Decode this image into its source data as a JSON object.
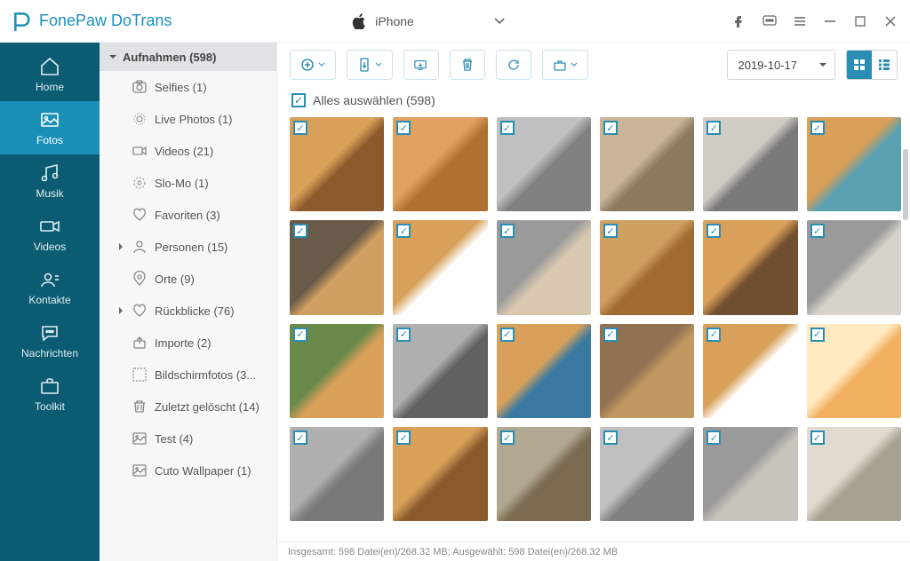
{
  "app": {
    "name": "FonePaw DoTrans"
  },
  "device": {
    "name": "iPhone"
  },
  "sidebar": {
    "items": [
      {
        "label": "Home"
      },
      {
        "label": "Fotos"
      },
      {
        "label": "Musik"
      },
      {
        "label": "Videos"
      },
      {
        "label": "Kontakte"
      },
      {
        "label": "Nachrichten"
      },
      {
        "label": "Toolkit"
      }
    ]
  },
  "categories": {
    "header": "Aufnahmen (598)",
    "items": [
      {
        "label": "Selfies (1)"
      },
      {
        "label": "Live Photos (1)"
      },
      {
        "label": "Videos (21)"
      },
      {
        "label": "Slo-Mo (1)"
      },
      {
        "label": "Favoriten (3)"
      },
      {
        "label": "Personen (15)",
        "expandable": true
      },
      {
        "label": "Orte (9)"
      },
      {
        "label": "Rückblicke (76)",
        "expandable": true
      },
      {
        "label": "Importe (2)"
      },
      {
        "label": "Bildschirmfotos (3..."
      },
      {
        "label": "Zuletzt gelöscht (14)"
      },
      {
        "label": "Test (4)"
      },
      {
        "label": "Cuto Wallpaper (1)"
      }
    ]
  },
  "selectAll": {
    "label": "Alles auswählen (598)"
  },
  "date": {
    "value": "2019-10-17"
  },
  "status": {
    "text": "Insgesamt: 598 Datei(en)/268.32 MB; Ausgewählt: 598 Datei(en)/268.32 MB"
  },
  "thumbs": [
    {
      "a": "#d9a05a",
      "b": "#8b5a2b"
    },
    {
      "a": "#e0a060",
      "b": "#b07030"
    },
    {
      "a": "#c0c0c0",
      "b": "#808080"
    },
    {
      "a": "#cab49a",
      "b": "#8a7a60"
    },
    {
      "a": "#d0ccc4",
      "b": "#7a7a7a"
    },
    {
      "a": "#d9a05a",
      "b": "#5aa0b0"
    },
    {
      "a": "#6a5a4a",
      "b": "#d0a060"
    },
    {
      "a": "#d9a05a",
      "b": "#ffffff"
    },
    {
      "a": "#9a9a9a",
      "b": "#d8c8b0"
    },
    {
      "a": "#d0a060",
      "b": "#a06a30"
    },
    {
      "a": "#d9a05a",
      "b": "#705030"
    },
    {
      "a": "#9a9a9a",
      "b": "#d8d4cc"
    },
    {
      "a": "#6a8a4a",
      "b": "#d9a05a"
    },
    {
      "a": "#b0b0b0",
      "b": "#606060"
    },
    {
      "a": "#d9a05a",
      "b": "#3a7aa0"
    },
    {
      "a": "#907050",
      "b": "#c09860"
    },
    {
      "a": "#d9a05a",
      "b": "#ffffff"
    },
    {
      "a": "#ffe9c0",
      "b": "#f0b060"
    },
    {
      "a": "#b0b0b0",
      "b": "#7a7a7a"
    },
    {
      "a": "#d9a05a",
      "b": "#8b5a2b"
    },
    {
      "a": "#b0a890",
      "b": "#7a6a50"
    },
    {
      "a": "#c0c0c0",
      "b": "#808080"
    },
    {
      "a": "#9a9a9a",
      "b": "#c8c4bc"
    },
    {
      "a": "#e0dad0",
      "b": "#a8a090"
    }
  ]
}
